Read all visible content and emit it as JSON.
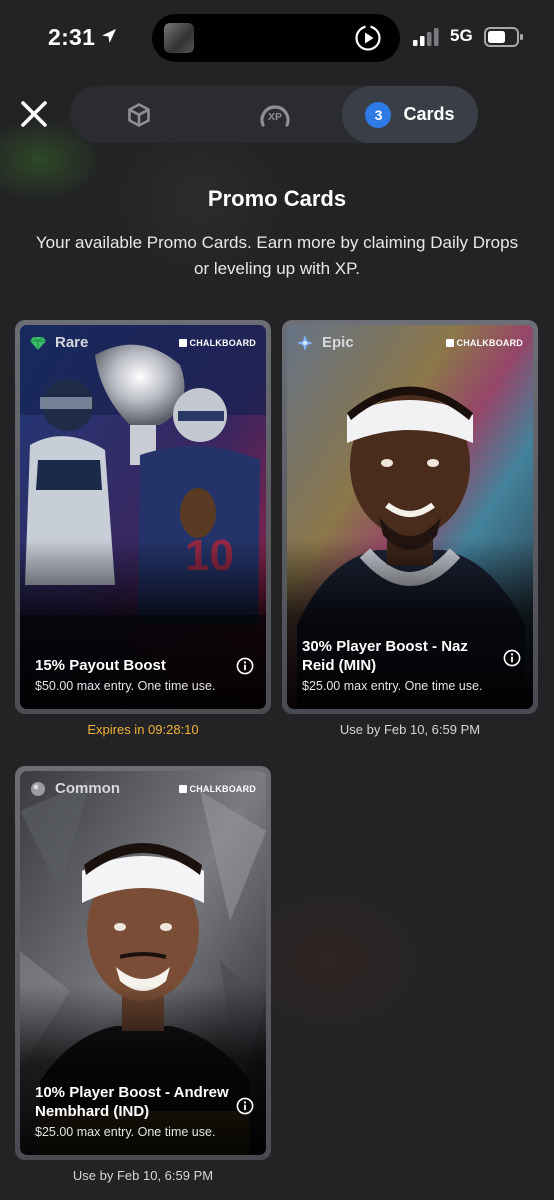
{
  "status_bar": {
    "time": "2:31",
    "network": "5G"
  },
  "tabs": {
    "cards_badge": "3",
    "cards_label": "Cards",
    "xp_label": "XP",
    "active": "Cards"
  },
  "header": {
    "title": "Promo Cards",
    "subtitle": "Your available Promo Cards. Earn more by claiming Daily Drops or leveling up with XP."
  },
  "brand": "CHALKBOARD",
  "cards": [
    {
      "tier": "Rare",
      "title": "15% Payout Boost",
      "description": "$50.00 max entry. One time use.",
      "footnote": "Expires in 09:28:10",
      "footnote_color": "#f0b23a"
    },
    {
      "tier": "Epic",
      "title": "30% Player Boost - Naz Reid (MIN)",
      "description": "$25.00 max entry. One time use.",
      "footnote": "Use by Feb 10, 6:59 PM",
      "footnote_color": "#d6d6da"
    },
    {
      "tier": "Common",
      "title": "10% Player Boost - Andrew Nembhard (IND)",
      "description": "$25.00 max entry. One time use.",
      "footnote": "Use by Feb 10, 6:59 PM",
      "footnote_color": "#d6d6da"
    }
  ],
  "colors": {
    "background": "#232325",
    "accent_blue": "#2f7be6",
    "expiry_orange": "#f0b23a",
    "rare_gem": "#37c06a",
    "epic_gem": "#7fb4ff",
    "common_gem": "#9a9ca2"
  },
  "icons": {
    "close": "close-icon",
    "box_tab": "cube-icon",
    "xp_tab": "xp-gauge-icon",
    "info": "info-icon",
    "location": "location-arrow-icon"
  }
}
